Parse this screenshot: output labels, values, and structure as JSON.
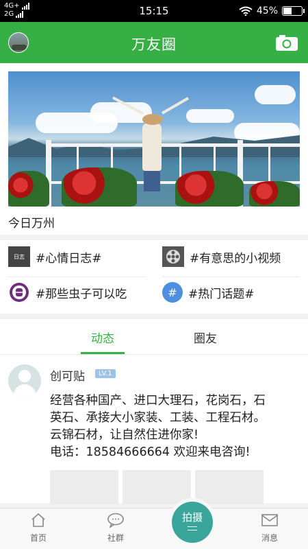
{
  "status_bar": {
    "network_top": "4G+",
    "network_bottom": "2G",
    "time": "15:15",
    "battery": "45%",
    "battery_level": 0.45
  },
  "header": {
    "title": "万友圈",
    "brand_color": "#36b044"
  },
  "banner": {
    "label": "今日万州"
  },
  "topics": [
    {
      "label": "#心情日志#",
      "icon": "mood-diary-icon"
    },
    {
      "label": "#有意思的小视频",
      "icon": "film-reel-icon"
    },
    {
      "label": "#那些虫子可以吃",
      "icon": "bug-icon"
    },
    {
      "label": "#热门话题#",
      "icon": "hashtag-icon"
    }
  ],
  "tabs": [
    {
      "label": "动态",
      "active": true
    },
    {
      "label": "圈友",
      "active": false
    }
  ],
  "post": {
    "author": "创可贴",
    "level": "LV.1",
    "text": "经营各种国产、进口大理石，花岗石，石\n英石、承接大小家装、工装、工程石材。\n云锦石材，让自然住进你家!\n电话：18584666664 欢迎来电咨询!"
  },
  "bottom_nav": {
    "home": "首页",
    "community": "社群",
    "shoot": "拍摄",
    "messages": "消息",
    "shoot_color": "#3aa59a"
  }
}
